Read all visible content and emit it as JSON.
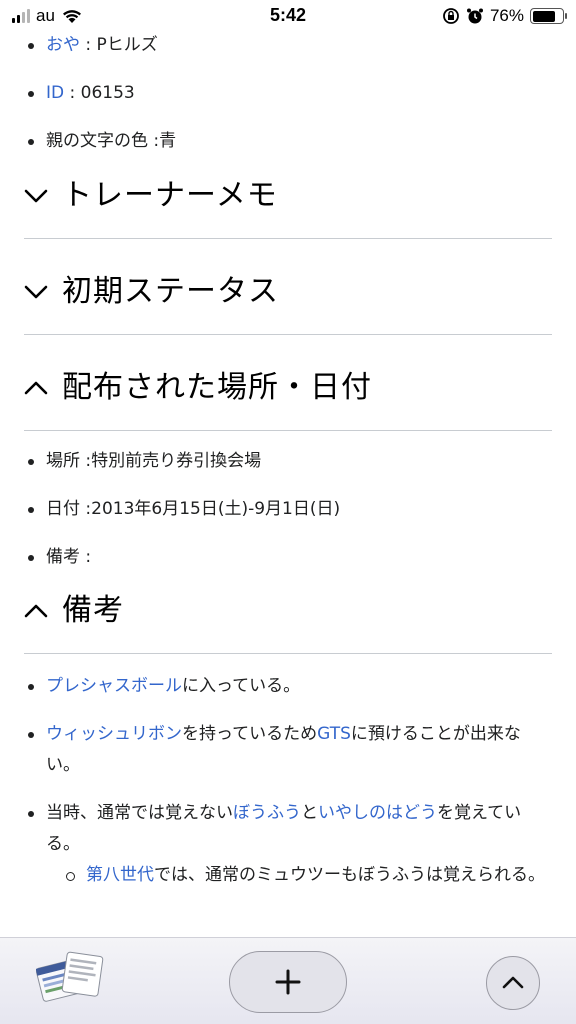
{
  "status": {
    "carrier": "au",
    "time": "5:42",
    "battery": "76%",
    "battery_level": 0.76
  },
  "top_list": [
    {
      "link": "おや",
      "rest": " : Pヒルズ"
    },
    {
      "link": "ID",
      "rest": " : 06153"
    },
    {
      "link": "",
      "rest": "親の文字の色 :青"
    }
  ],
  "sections": {
    "trainer_memo": "トレーナーメモ",
    "initial_status": "初期ステータス",
    "distribution": "配布された場所・日付",
    "notes": "備考"
  },
  "distribution_list": [
    "場所 :特別前売り券引換会場",
    "日付 :2013年6月15日(土)-9月1日(日)",
    "備考 :"
  ],
  "notes_list": {
    "item1": {
      "link": "プレシャスボール",
      "rest": "に入っている。"
    },
    "item2": {
      "link1": "ウィッシュリボン",
      "text1": "を持っているため",
      "link2": "GTS",
      "text2": "に預けることが出来ない。"
    },
    "item3": {
      "text1": "当時、通常では覚えない",
      "link1": "ぼうふう",
      "text2": "と",
      "link2": "いやしのはどう",
      "text3": "を覚えている。"
    },
    "sub1": {
      "link": "第八世代",
      "rest": "では、通常のミュウツーもぼうふうは覚えられる。"
    }
  },
  "toolbar": {
    "tabs_icon": "tabs-icon",
    "plus_icon": "plus-icon",
    "up_icon": "chevron-up-icon"
  }
}
